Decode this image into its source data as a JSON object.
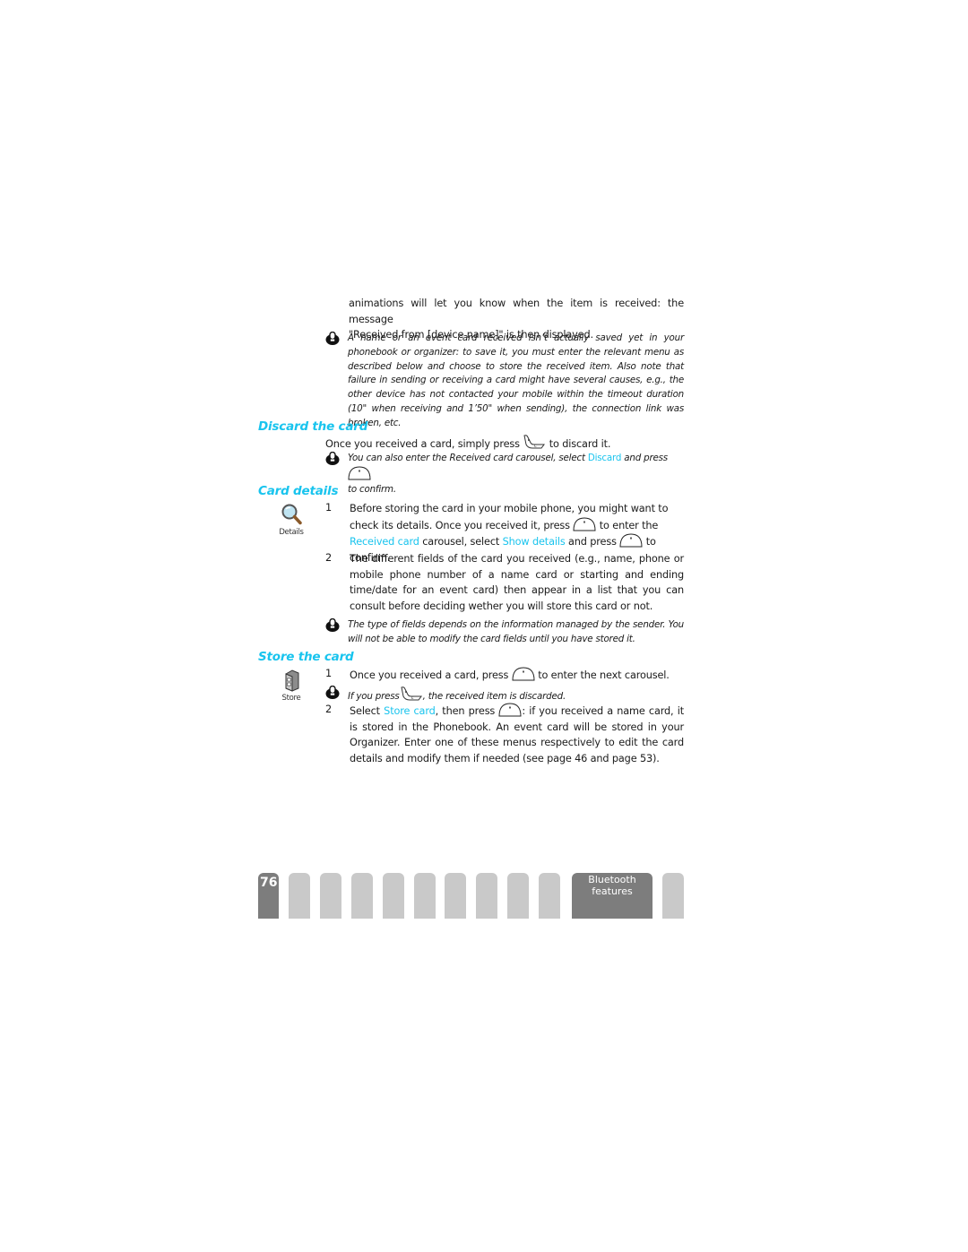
{
  "intro": {
    "line1": "animations will let you know when the item is received: the message",
    "line2": "\"Received from [device name]\" is then displayed."
  },
  "note1": {
    "icon": "warning-note-icon",
    "text": "A name or an event card received isn’t actually saved yet in your phonebook or organizer: to save it, you must enter the relevant menu as described below and choose to store the received item. Also note that failure in sending or receiving a card might have several causes, e.g., the other device has not contacted your mobile within the timeout duration (10\" when receiving and 1’50\" when sending), the connection link was broken, etc."
  },
  "discard": {
    "title": "Discard the card",
    "text_before": "Once you received a card, simply press",
    "key_icon": "hangup-c-key-icon",
    "text_after": "to discard it.",
    "note": {
      "before": "You can also enter the Received card carousel, select",
      "highlight": "Discard",
      "middle": "and press",
      "key_icon": "ok-key-icon",
      "after": "to confirm."
    }
  },
  "details": {
    "title": "Card details",
    "side_icon": "magnifier-icon",
    "side_label": "Details",
    "steps": [
      {
        "num": "1",
        "p1": "Before storing the card in your mobile phone, you might want to check its details. Once you received it, press",
        "p2": "to enter the",
        "hl1": "Received card",
        "p3": "carousel, select",
        "hl2": "Show details",
        "p4": "and press",
        "p5": "to confirm."
      },
      {
        "num": "2",
        "text": "The different fields of the card you received (e.g., name, phone or mobile phone number of a name card or starting and ending time/date for an event card) then appear in a list that you can consult before deciding wether you will store this card or not."
      }
    ],
    "note": "The type of fields depends on the information managed by the sender. You will not be able to modify the card fields until you have stored it."
  },
  "store": {
    "title": "Store the card",
    "side_icon": "filing-cabinet-icon",
    "side_label": "Store",
    "step1": {
      "num": "1",
      "before": "Once you received a card, press",
      "after": "to enter the next carousel."
    },
    "note": {
      "before": "If you press",
      "after": ", the received item is discarded."
    },
    "step2": {
      "num": "2",
      "p1": "Select",
      "hl": "Store card",
      "p2": ", then press",
      "p3": ": if you received a name card, it is stored in the Phonebook. An event card will be stored in your Organizer. Enter one of these menus respectively to edit the card details and modify them if needed (see page 46 and page 53)."
    }
  },
  "footer": {
    "page_number": "76",
    "section_tab": "Bluetooth features",
    "section_line1": "Bluetooth",
    "section_line2": "features",
    "colors": {
      "active": "#7d7d7d",
      "inactive": "#c9c9c9",
      "accent": "#19c4ee"
    }
  }
}
